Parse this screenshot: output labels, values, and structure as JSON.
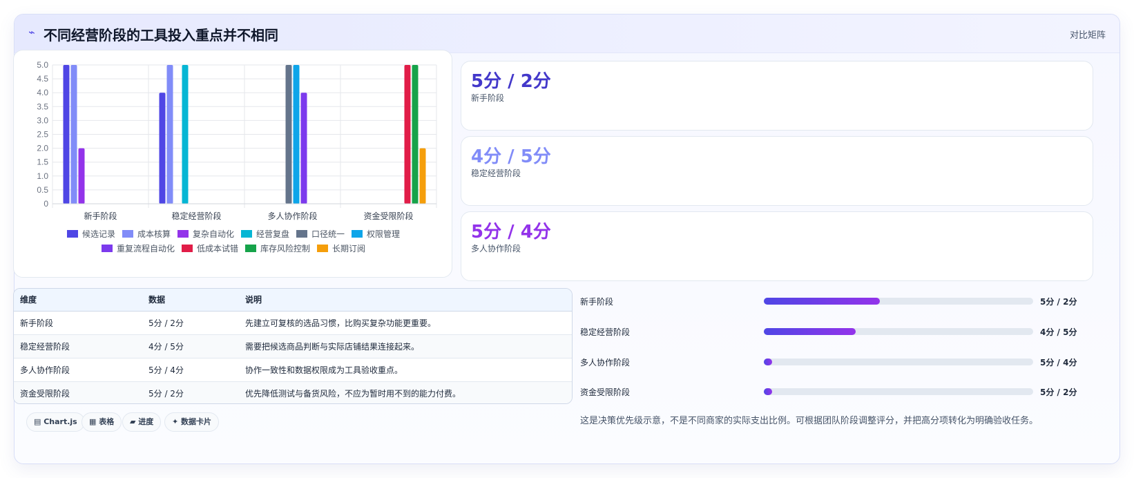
{
  "header": {
    "title": "不同经营阶段的工具投入重点并不相同",
    "badge": "对比矩阵",
    "title_icon": "trend-icon"
  },
  "chart_data": {
    "type": "bar",
    "categories": [
      "新手阶段",
      "稳定经营阶段",
      "多人协作阶段",
      "资金受限阶段"
    ],
    "yticks": [
      "0",
      "0.5",
      "1.0",
      "1.5",
      "2.0",
      "2.5",
      "3.0",
      "3.5",
      "4.0",
      "4.5",
      "5.0"
    ],
    "ylim": [
      0,
      5
    ],
    "grid": true,
    "legend_position": "bottom",
    "series": [
      {
        "name": "候选记录",
        "color": "#4f46e5",
        "values": [
          5,
          4,
          null,
          null
        ]
      },
      {
        "name": "成本核算",
        "color": "#818cf8",
        "values": [
          5,
          5,
          null,
          null
        ]
      },
      {
        "name": "复杂自动化",
        "color": "#9333ea",
        "values": [
          2,
          null,
          null,
          null
        ]
      },
      {
        "name": "经营复盘",
        "color": "#06b6d4",
        "values": [
          null,
          5,
          null,
          null
        ]
      },
      {
        "name": "口径统一",
        "color": "#64748b",
        "values": [
          null,
          null,
          5,
          null
        ]
      },
      {
        "name": "权限管理",
        "color": "#0ea5e9",
        "values": [
          null,
          null,
          5,
          null
        ]
      },
      {
        "name": "重复流程自动化",
        "color": "#7c3aed",
        "values": [
          null,
          null,
          4,
          null
        ]
      },
      {
        "name": "低成本试错",
        "color": "#e11d48",
        "values": [
          null,
          null,
          null,
          5
        ]
      },
      {
        "name": "库存风险控制",
        "color": "#16a34a",
        "values": [
          null,
          null,
          null,
          5
        ]
      },
      {
        "name": "长期订阅",
        "color": "#f59e0b",
        "values": [
          null,
          null,
          null,
          2
        ]
      }
    ]
  },
  "stats": [
    {
      "value": "5分 / 2分",
      "label": "新手阶段",
      "color": "#4338ca"
    },
    {
      "value": "4分 / 5分",
      "label": "稳定经营阶段",
      "color": "#818cf8"
    },
    {
      "value": "5分 / 4分",
      "label": "多人协作阶段",
      "color": "#9333ea"
    }
  ],
  "table": {
    "headers": [
      "维度",
      "数据",
      "说明"
    ],
    "rows": [
      [
        "新手阶段",
        "5分 / 2分",
        "先建立可复核的选品习惯，比购买复杂功能更重要。"
      ],
      [
        "稳定经营阶段",
        "4分 / 5分",
        "需要把候选商品判断与实际店铺结果连接起来。"
      ],
      [
        "多人协作阶段",
        "5分 / 4分",
        "协作一致性和数据权限成为工具验收重点。"
      ],
      [
        "资金受限阶段",
        "5分 / 2分",
        "优先降低测试与备货风险，不应为暂时用不到的能力付费。"
      ]
    ]
  },
  "chips": [
    "▤ Chart.js",
    "▦ 表格",
    "▰ 进度",
    "✦ 数据卡片"
  ],
  "progress": [
    {
      "label": "新手阶段",
      "value": "5分 / 2分",
      "fraction": 0.43
    },
    {
      "label": "稳定经营阶段",
      "value": "4分 / 5分",
      "fraction": 0.34
    },
    {
      "label": "多人协作阶段",
      "value": "5分 / 4分",
      "fraction": 0.03
    },
    {
      "label": "资金受限阶段",
      "value": "5分 / 2分",
      "fraction": 0.03
    }
  ],
  "note": "这是决策优先级示意，不是不同商家的实际支出比例。可根据团队阶段调整评分，并把高分项转化为明确验收任务。"
}
